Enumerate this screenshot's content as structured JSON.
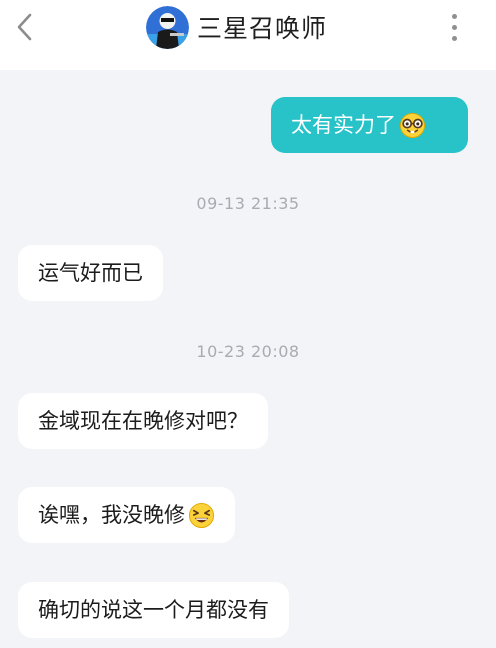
{
  "header": {
    "title": "三星召唤师",
    "back_icon": "chevron-left-icon",
    "more_icon": "vertical-dots-icon"
  },
  "messages": [
    {
      "side": "out",
      "text": "太有实力了",
      "emoji": "nerd-face-emoji"
    },
    {
      "type": "time",
      "text": "09-13 21:35"
    },
    {
      "side": "in",
      "text": "运气好而已"
    },
    {
      "type": "time",
      "text": "10-23 20:08"
    },
    {
      "side": "in",
      "text": "金域现在在晚修对吧？"
    },
    {
      "side": "in",
      "text": "诶嘿，我没晚修",
      "emoji": "laughing-face-emoji"
    },
    {
      "side": "in",
      "text": "确切的说这一个月都没有"
    }
  ],
  "colors": {
    "outgoing_bubble": "#27c3c8",
    "incoming_bubble": "#ffffff",
    "background": "#f3f4f7",
    "timestamp": "#a9abb1"
  }
}
